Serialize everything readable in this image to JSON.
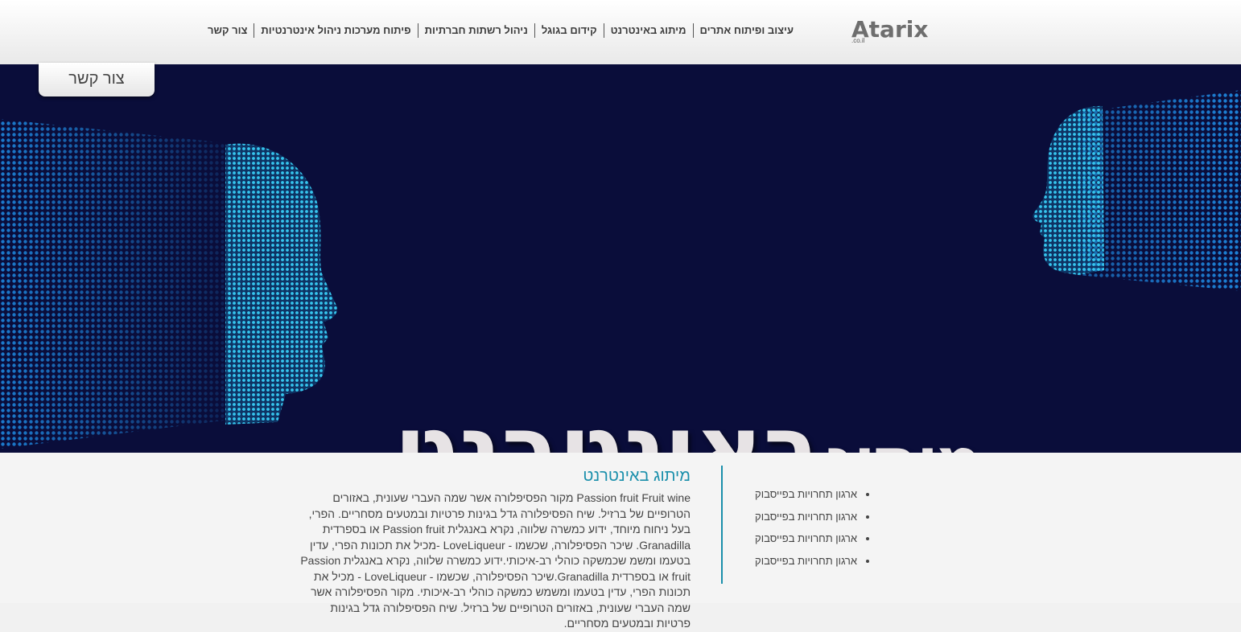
{
  "logo": {
    "name": "Atarix",
    "domain": ".co.il"
  },
  "nav": [
    "עיצוב ופיתוח אתרים",
    "מיתוג באינטרנט",
    "קידום בגוגל",
    "ניהול רשתות חברתיות",
    "פיתוח מערכות ניהול אינטרנטיות",
    "צור קשר"
  ],
  "contact_button": "צור קשר",
  "hero": {
    "title_word1": "מיתוג",
    "title_word2": "באינטרנט"
  },
  "article": {
    "heading": "מיתוג באינטרנט",
    "body": "Passion fruit Fruit wine מקור הפסיפלורה אשר שמה העברי שעונית, באזורים הטרופיים של ברזיל. שיח הפסיפלורה גדל בגינות פרטיות ובמטעים מסחריים. הפרי, בעל ניחוח מיוחד, ידוע כמשרה שלווה, נקרא באנגלית  Passion fruit  או בספרדית Granadilla. שיכר הפסיפלורה, שכשמו - LoveLiqueur -מכיל את תכונות הפרי, עדין בטעמו ומשמ שכמשקה כוהלי רב-איכותי.ידוע כמשרה שלווה, נקרא באנגלית Passion fruit או בספרדית Granadilla.שיכר הפסיפלורה, שכשמו - LoveLiqueur - מכיל את תכונות הפרי, עדין בטעמו ומשמש כמשקה כוהלי רב-איכותי. מקור הפסיפלורה אשר שמה העברי שעונית, באזורים הטרופיים של ברזיל. שיח הפסיפלורה גדל בגינות פרטיות ובמטעים מסחריים."
  },
  "sidebar": [
    "ארגון תחרויות בפייסבוק",
    "ארגון תחרויות בפייסבוק",
    "ארגון תחרויות בפייסבוק",
    "ארגון תחרויות בפייסבוק"
  ],
  "colors": {
    "hero_bg": "#0a0d3a",
    "accent": "#1a8fab",
    "face_light": "#36c6f0",
    "face_dark": "#0a4fb0"
  }
}
